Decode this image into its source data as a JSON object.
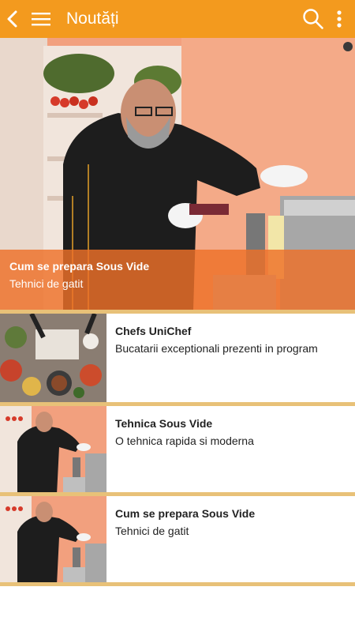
{
  "appbar": {
    "title": "Noutăți"
  },
  "hero": {
    "title": "Cum se prepara Sous Vide",
    "subtitle": "Tehnici de gatit"
  },
  "items": [
    {
      "title": "Chefs UniChef",
      "subtitle": "Bucatarii exceptionali prezenti in program"
    },
    {
      "title": "Tehnica Sous Vide",
      "subtitle": "O tehnica rapida si moderna"
    },
    {
      "title": "Cum se prepara Sous Vide",
      "subtitle": "Tehnici de gatit"
    }
  ],
  "colors": {
    "appbar": "#f39a1e",
    "caption": "#ee7028",
    "separator": "#e8c178"
  }
}
